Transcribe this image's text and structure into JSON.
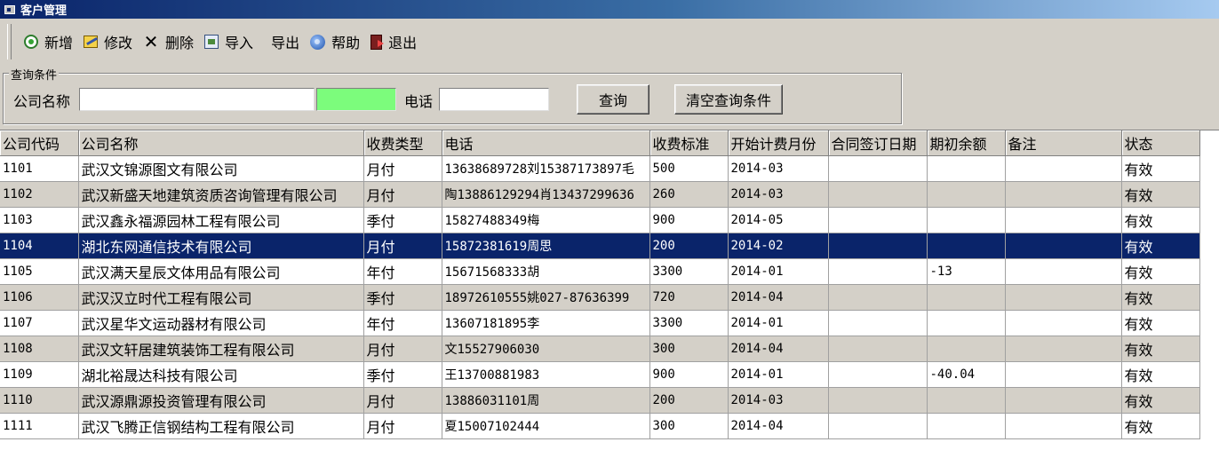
{
  "window": {
    "title": "客户管理"
  },
  "toolbar": {
    "add": "新增",
    "edit": "修改",
    "delete": "删除",
    "import": "导入",
    "export": "导出",
    "help": "帮助",
    "exit": "退出"
  },
  "query": {
    "legend": "查询条件",
    "company_label": "公司名称",
    "company_value": "",
    "extra_value": "",
    "phone_label": "电话",
    "phone_value": "",
    "search_button": "查询",
    "clear_button": "清空查询条件"
  },
  "grid": {
    "columns": [
      "公司代码",
      "公司名称",
      "收费类型",
      "电话",
      "收费标准",
      "开始计费月份",
      "合同签订日期",
      "期初余额",
      "备注",
      "状态"
    ],
    "selected_row": 3,
    "rows": [
      [
        "1101",
        "武汉文锦源图文有限公司",
        "月付",
        "13638689728刘15387173897毛",
        "500",
        "2014-03",
        "",
        "",
        "",
        "有效"
      ],
      [
        "1102",
        "武汉新盛天地建筑资质咨询管理有限公司",
        "月付",
        "陶13886129294肖13437299636",
        "260",
        "2014-03",
        "",
        "",
        "",
        "有效"
      ],
      [
        "1103",
        "武汉鑫永福源园林工程有限公司",
        "季付",
        "15827488349梅",
        "900",
        "2014-05",
        "",
        "",
        "",
        "有效"
      ],
      [
        "1104",
        "湖北东网通信技术有限公司",
        "月付",
        "15872381619周思",
        "200",
        "2014-02",
        "",
        "",
        "",
        "有效"
      ],
      [
        "1105",
        "武汉满天星辰文体用品有限公司",
        "年付",
        "15671568333胡",
        "3300",
        "2014-01",
        "",
        "-13",
        "",
        "有效"
      ],
      [
        "1106",
        "武汉汉立时代工程有限公司",
        "季付",
        "18972610555姚027-87636399",
        "720",
        "2014-04",
        "",
        "",
        "",
        "有效"
      ],
      [
        "1107",
        "武汉星华文运动器材有限公司",
        "年付",
        "13607181895李",
        "3300",
        "2014-01",
        "",
        "",
        "",
        "有效"
      ],
      [
        "1108",
        "武汉文轩居建筑装饰工程有限公司",
        "月付",
        "文15527906030",
        "300",
        "2014-04",
        "",
        "",
        "",
        "有效"
      ],
      [
        "1109",
        "湖北裕晟达科技有限公司",
        "季付",
        "王13700881983",
        "900",
        "2014-01",
        "",
        "-40.04",
        "",
        "有效"
      ],
      [
        "1110",
        "武汉源鼎源投资管理有限公司",
        "月付",
        "13886031101周",
        "200",
        "2014-03",
        "",
        "",
        "",
        "有效"
      ],
      [
        "1111",
        "武汉飞腾正信钢结构工程有限公司",
        "月付",
        "夏15007102444",
        "300",
        "2014-04",
        "",
        "",
        "",
        "有效"
      ]
    ]
  }
}
